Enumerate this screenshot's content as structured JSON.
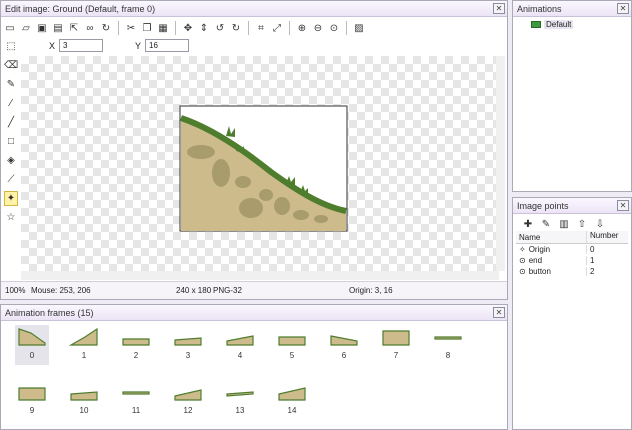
{
  "editor": {
    "title": "Edit image: Ground (Default, frame 0)",
    "close": "✕",
    "toolbar_icons": [
      "new-icon",
      "open-icon",
      "save-icon",
      "save-all-icon",
      "export-icon",
      "link-icon",
      "refresh-icon",
      "cut-icon",
      "copy-icon",
      "paste-icon",
      "move-icon",
      "move-vert-icon",
      "rotate-left-icon",
      "rotate-right-icon",
      "crop-icon",
      "resize-icon",
      "zoom-in-icon",
      "zoom-out-icon",
      "zoom-fit-icon",
      "properties-icon"
    ],
    "x_label": "X",
    "x_value": "3",
    "y_label": "Y",
    "y_value": "16",
    "tools": [
      "select-rect-icon",
      "eraser-icon",
      "pencil-icon",
      "brush-icon",
      "line-icon",
      "rect-icon",
      "fill-icon",
      "eyedropper-icon",
      "origin-icon",
      "star-icon"
    ],
    "status": {
      "zoom": "100%",
      "mouse": "Mouse: 253, 206",
      "size": "240 x 180",
      "format": "PNG-32",
      "origin": "Origin: 3, 16"
    }
  },
  "frames_panel": {
    "title": "Animation frames (15)",
    "frames": [
      "0",
      "1",
      "2",
      "3",
      "4",
      "5",
      "6",
      "7",
      "8",
      "9",
      "10",
      "11",
      "12",
      "13",
      "14"
    ]
  },
  "animations_panel": {
    "title": "Animations",
    "items": [
      "Default"
    ]
  },
  "image_points_panel": {
    "title": "Image points",
    "columns": [
      "Name",
      "Number"
    ],
    "rows": [
      {
        "name": "Origin",
        "number": "0"
      },
      {
        "name": "end",
        "number": "1"
      },
      {
        "name": "button",
        "number": "2"
      }
    ]
  },
  "colors": {
    "grass": "#4e7d2e",
    "dirt": "#cdbb8c",
    "rock": "#a89b6c"
  }
}
